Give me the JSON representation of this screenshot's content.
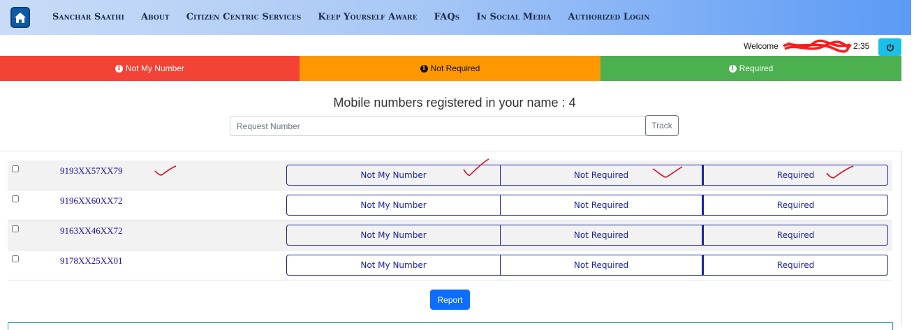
{
  "navbar": {
    "home_icon": "home-icon",
    "items": [
      {
        "label": "Sanchar Saathi"
      },
      {
        "label": "About"
      },
      {
        "label": "Citizen Centric Services"
      },
      {
        "label": "Keep Yourself Aware"
      },
      {
        "label": "FAQs"
      },
      {
        "label": "In Social Media"
      },
      {
        "label": "Authorized Login"
      }
    ]
  },
  "header": {
    "welcome_label": "Welcome",
    "time": "2:35",
    "logout_icon": "power-icon"
  },
  "legend": {
    "not_my_number": "Not My Number",
    "not_required": "Not Required",
    "required": "Required",
    "colors": {
      "not_my_number": "#f44336",
      "not_required": "#ff9800",
      "required": "#4caf50"
    }
  },
  "main": {
    "heading": "Mobile numbers registered in your name : 4",
    "request_placeholder": "Request Number",
    "track_label": "Track",
    "report_label": "Report",
    "option_labels": {
      "o1": "Not My Number",
      "o2": "Not Required",
      "o3": "Required"
    },
    "numbers": [
      {
        "number": "9193XX57XX79"
      },
      {
        "number": "9196XX60XX72"
      },
      {
        "number": "9163XX46XX72"
      },
      {
        "number": "9178XX25XX01"
      }
    ]
  }
}
